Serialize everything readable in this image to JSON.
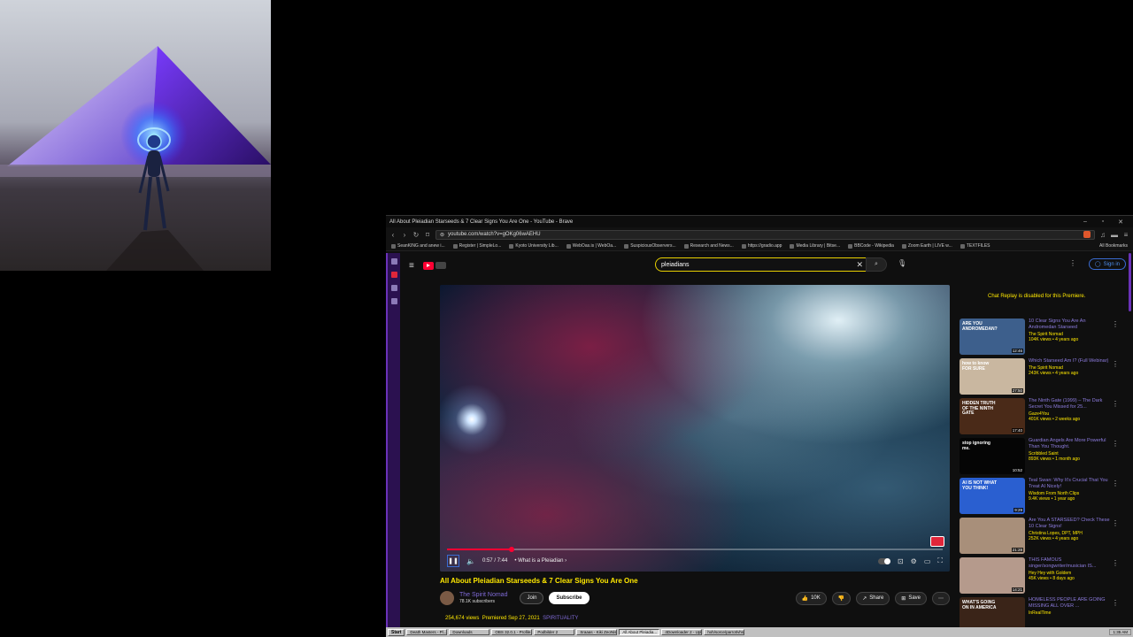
{
  "window_title": "All About Pleiadian Starseeds & 7 Clear Signs You Are One - YouTube - Brave",
  "url": "youtube.com/watch?v=gOKg06wAEHU",
  "bookmarks": [
    "SeanKING and anew i...",
    "Register | SimpleLo...",
    "Kyoto University Lib...",
    "WebOas.is | WebOa...",
    "SuspiciousObservers...",
    "Research and News...",
    "https://gradio.app",
    "Media Library | Bitse...",
    "BBCode - Wikipedia",
    "Zoom Earth | LIVE w...",
    "TEXTFILES"
  ],
  "bookmarks_right": "All Bookmarks",
  "search": {
    "value": "pleiadians"
  },
  "signin_label": "Sign in",
  "player": {
    "time": "0:57 / 7:44",
    "chapter": "What is a Pleiadian",
    "progress": 0.13
  },
  "video": {
    "title": "All About Pleiadian Starseeds & 7 Clear Signs You Are One",
    "channel": "The Spirit Nomad",
    "subscribers": "78.1K subscribers",
    "join_label": "Join",
    "subscribe_label": "Subscribe",
    "likes": "10K",
    "share_label": "Share",
    "save_label": "Save",
    "views": "254,674 views",
    "premiered": "Premiered Sep 27, 2021",
    "tag": "SPIRITUALITY"
  },
  "chat_note": "Chat Replay is disabled for this Premiere.",
  "recommendations": [
    {
      "title": "10 Clear Signs You Are An Andromedan Starseed",
      "channel": "The Spirit Nomad",
      "meta": "104K views • 4 years ago",
      "duration": "12:46",
      "color": "#3d5f8c"
    },
    {
      "title": "Which Starseed Am I? (Full Webinar)",
      "channel": "The Spirit Nomad",
      "meta": "243K views • 4 years ago",
      "duration": "27:50",
      "color": "#c9b7a0"
    },
    {
      "title": "The Ninth Gate (1999) – The Dark Secret You Missed for 25...",
      "channel": "Gaze4You",
      "meta": "401K views • 2 weeks ago",
      "duration": "17:40",
      "color": "#4a2a18"
    },
    {
      "title": "Guardian Angels Are More Powerful Than You Thought.",
      "channel": "Scribbled Saint",
      "meta": "893K views • 1 month ago",
      "duration": "10:52",
      "color": "#050505"
    },
    {
      "title": "Teal Swan: Why It's Crucial That You Treat AI Nicely!",
      "channel": "Wisdom From North Clips",
      "meta": "9.4K views • 1 year ago",
      "duration": "9:29",
      "color": "#2a5fd0"
    },
    {
      "title": "Are You A STARSEED? Check These 10 Clear Signs!",
      "channel": "Christina Lopes, DPT, MPH",
      "meta": "252K views • 4 years ago",
      "duration": "21:28",
      "color": "#a88f7a"
    },
    {
      "title": "THIS FAMOUS singer/songwriter/musician IS...",
      "channel": "Hey Hey with Goldem",
      "meta": "45K views • 8 days ago",
      "duration": "14:21",
      "color": "#b59a8c"
    },
    {
      "title": "HOMELESS PEOPLE ARE GOING MISSING ALL OVER ...",
      "channel": "InRealTime",
      "meta": "",
      "duration": "",
      "color": "#3a2418"
    }
  ],
  "thumb_captions": [
    "ARE YOU ANDROMEDAN?",
    "how to know FOR SURE",
    "HIDDEN TRUTH OF THE NINTH GATE",
    "stop ignoring me.",
    "AI IS NOT WHAT YOU THINK!",
    "",
    "",
    "WHAT'S GOING ON IN AMERICA"
  ],
  "taskbar": {
    "start": "Start",
    "tasks": [
      "Death Masters - Pl...",
      "Downloads",
      "OBS 32.0.1 - Profile...",
      "Podbilder 2",
      "Sraaas - Kiki ZeoNis...",
      "All About Pleiadia...",
      "4Downloader 2 - Upl...",
      "hxh/sorce/parrot/vhs..."
    ],
    "clock": "1:35 AM"
  }
}
